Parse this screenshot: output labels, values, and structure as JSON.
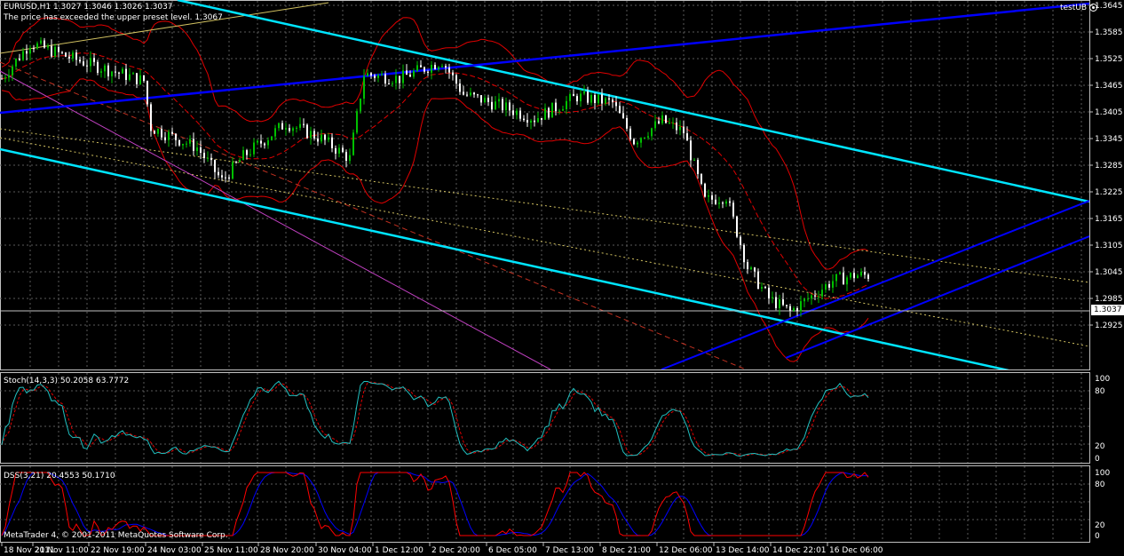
{
  "header": {
    "symbol_info": "EURUSD,H1  1.3027 1.3046 1.3026 1.3037",
    "alert": "The price has exceeded the upper preset level. 1.3067",
    "ea_name": "testUB",
    "ea_icon": "smiley-icon"
  },
  "current_price": "1.3037",
  "price_axis": [
    "1.3645",
    "1.3585",
    "1.3525",
    "1.3465",
    "1.3405",
    "1.3345",
    "1.3285",
    "1.3225",
    "1.3165",
    "1.3105",
    "1.3045",
    "1.2985",
    "1.2925"
  ],
  "time_axis": [
    "18 Nov 2011",
    "21 Nov 11:00",
    "22 Nov 19:00",
    "24 Nov 03:00",
    "25 Nov 11:00",
    "28 Nov 20:00",
    "30 Nov 04:00",
    "1 Dec 12:00",
    "2 Dec 20:00",
    "6 Dec 05:00",
    "7 Dec 13:00",
    "8 Dec 21:00",
    "12 Dec 06:00",
    "13 Dec 14:00",
    "14 Dec 22:01",
    "16 Dec 06:00"
  ],
  "stoch": {
    "label": "Stoch(14,3,3) 50.2058 63.7772",
    "levels": [
      "100",
      "80",
      "20",
      "0"
    ]
  },
  "dss": {
    "label": "DSS(3,21) 20.4553 50.1710",
    "levels": [
      "100",
      "80",
      "20",
      "0"
    ]
  },
  "footer": {
    "copyright": "MetaTrader 4, © 2001-2011 MetaQuotes Software Corp."
  },
  "colors": {
    "background": "#000000",
    "bull_candle": "#00c000",
    "bear_candle": "#ffffff",
    "channel_cyan": "#00e5ff",
    "trend_blue": "#0000ff",
    "bands_red": "#e00000",
    "stoch_main": "#20c0c0",
    "stoch_signal": "#e00000",
    "dss_main": "#0000ff",
    "dss_signal": "#ff0000",
    "grid": "#5a5a5a"
  }
}
